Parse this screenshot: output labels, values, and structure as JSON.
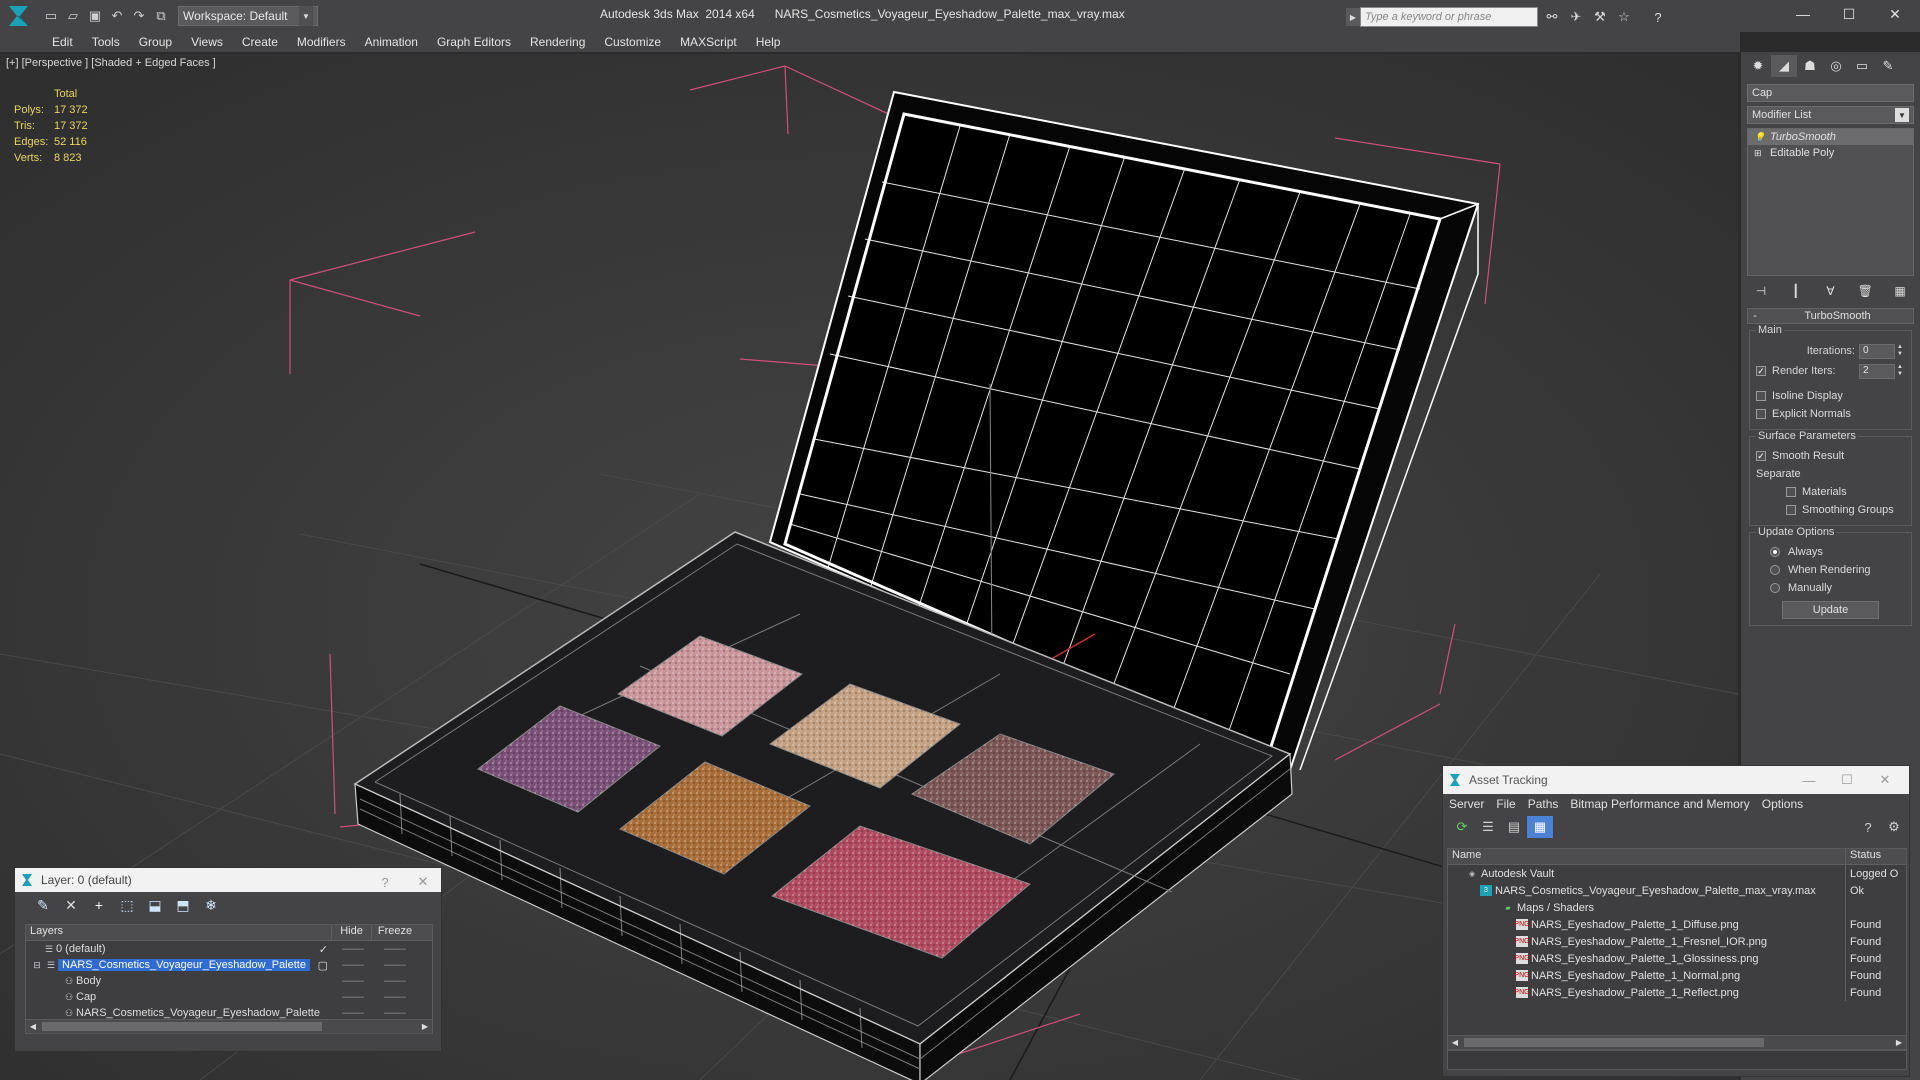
{
  "app": {
    "title": "Autodesk 3ds Max  2014 x64      NARS_Cosmetics_Voyageur_Eyeshadow_Palette_max_vray.max",
    "workspace": "Workspace: Default",
    "search_placeholder": "Type a keyword or phrase"
  },
  "menu": [
    "Edit",
    "Tools",
    "Group",
    "Views",
    "Create",
    "Modifiers",
    "Animation",
    "Graph Editors",
    "Rendering",
    "Customize",
    "MAXScript",
    "Help"
  ],
  "viewport": {
    "label": "[+] [Perspective ] [Shaded + Edged Faces ]",
    "stats": {
      "header": "Total",
      "rows": [
        {
          "label": "Polys:",
          "value": "17 372"
        },
        {
          "label": "Tris:",
          "value": "17 372"
        },
        {
          "label": "Edges:",
          "value": "52 116"
        },
        {
          "label": "Verts:",
          "value": "8 823"
        }
      ]
    }
  },
  "command_panel": {
    "object_name": "Cap",
    "modifier_list": "Modifier List",
    "stack": [
      {
        "label": "TurboSmooth",
        "selected": true
      },
      {
        "label": "Editable Poly",
        "selected": false
      }
    ],
    "rollout_title": "TurboSmooth",
    "main_group": "Main",
    "iterations_label": "Iterations:",
    "iterations_value": "0",
    "render_iters_label": "Render Iters:",
    "render_iters_value": "2",
    "isoline_label": "Isoline Display",
    "explicit_label": "Explicit Normals",
    "surface_group": "Surface Parameters",
    "smooth_result": "Smooth Result",
    "separate_label": "Separate",
    "materials_label": "Materials",
    "smoothing_groups_label": "Smoothing Groups",
    "update_group": "Update Options",
    "always_label": "Always",
    "when_rendering_label": "When Rendering",
    "manually_label": "Manually",
    "update_button": "Update"
  },
  "layer_dialog": {
    "title": "Layer: 0 (default)",
    "help": "?",
    "close": "✕",
    "col_layers": "Layers",
    "col_hide": "Hide",
    "col_freeze": "Freeze",
    "rows": [
      {
        "name": "0 (default)",
        "indent": 1,
        "selected": false
      },
      {
        "name": "NARS_Cosmetics_Voyageur_Eyeshadow_Palette",
        "indent": 1,
        "selected": true
      },
      {
        "name": "Body",
        "indent": 2,
        "selected": false
      },
      {
        "name": "Cap",
        "indent": 2,
        "selected": false
      },
      {
        "name": "NARS_Cosmetics_Voyageur_Eyeshadow_Palette",
        "indent": 2,
        "selected": false
      }
    ]
  },
  "asset_dialog": {
    "title": "Asset Tracking",
    "menu": [
      "Server",
      "File",
      "Paths",
      "Bitmap Performance and Memory",
      "Options"
    ],
    "col_name": "Name",
    "col_status": "Status",
    "rows": [
      {
        "name": "Autodesk Vault",
        "status": "Logged O",
        "indent": 1,
        "icon": "vault"
      },
      {
        "name": "NARS_Cosmetics_Voyageur_Eyeshadow_Palette_max_vray.max",
        "status": "Ok",
        "indent": 2,
        "icon": "max"
      },
      {
        "name": "Maps / Shaders",
        "status": "",
        "indent": 3,
        "icon": "maps"
      },
      {
        "name": "NARS_Eyeshadow_Palette_1_Diffuse.png",
        "status": "Found",
        "indent": 4,
        "icon": "png"
      },
      {
        "name": "NARS_Eyeshadow_Palette_1_Fresnel_IOR.png",
        "status": "Found",
        "indent": 4,
        "icon": "png"
      },
      {
        "name": "NARS_Eyeshadow_Palette_1_Glossiness.png",
        "status": "Found",
        "indent": 4,
        "icon": "png"
      },
      {
        "name": "NARS_Eyeshadow_Palette_1_Normal.png",
        "status": "Found",
        "indent": 4,
        "icon": "png"
      },
      {
        "name": "NARS_Eyeshadow_Palette_1_Reflect.png",
        "status": "Found",
        "indent": 4,
        "icon": "png"
      }
    ]
  },
  "colors": {
    "stats_yellow": "#e8d65a",
    "selection_blue": "#2f6bd4"
  }
}
